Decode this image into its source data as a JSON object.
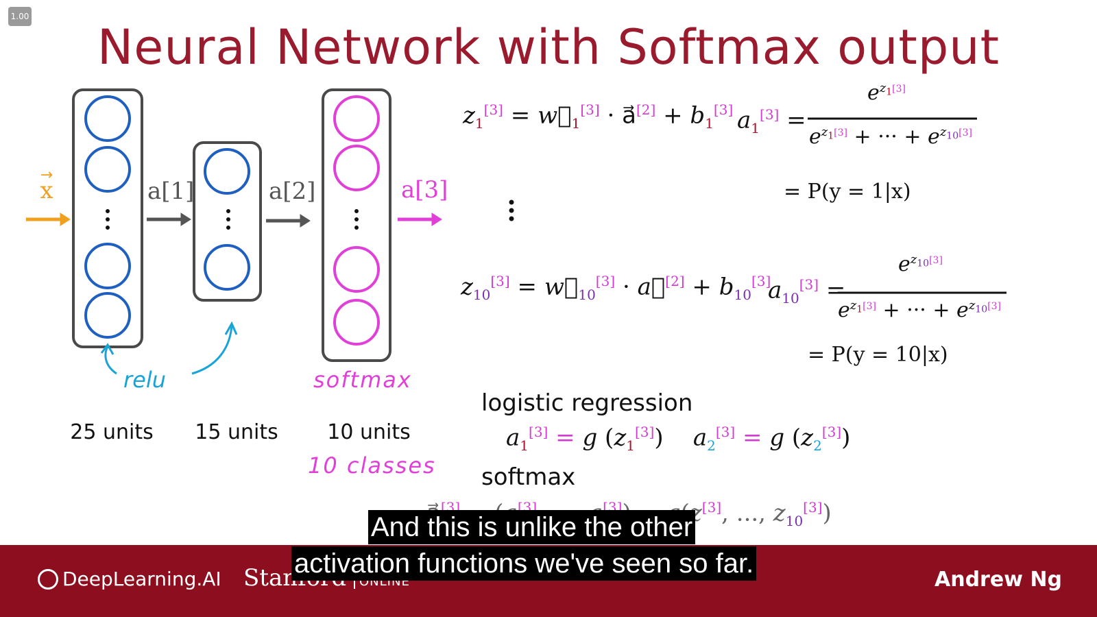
{
  "player": {
    "speed": "1.00"
  },
  "slide": {
    "title": "Neural Network with Softmax output",
    "input_label": "x",
    "activation_labels": [
      "a[1]",
      "a[2]",
      "a[3]"
    ],
    "hand_notes": {
      "relu": "relu",
      "softmax": "softmax",
      "classes": "10 classes"
    },
    "layer_units": [
      "25 units",
      "15 units",
      "10 units"
    ],
    "vertical_ellipsis": "⋮",
    "equations": {
      "p1": "= P(y = 1|x)",
      "p10": "= P(y = 10|x)"
    },
    "logistic_label": "logistic regression",
    "softmax_label": "softmax"
  },
  "caption": {
    "line1": "And this is unlike the other",
    "line2": "activation functions we've seen so far."
  },
  "footer": {
    "logo_text": "DeepLearning.AI",
    "stanford": "Stanford",
    "online": "ONLINE",
    "presenter": "Andrew Ng"
  },
  "colors": {
    "title": "#9b1b2e",
    "hidden_units": "#1f5fbf",
    "softmax_units": "#e040d8",
    "input_arrow": "#f0a020",
    "relu_note": "#1aa3d6",
    "footer": "#8d0f1f"
  }
}
